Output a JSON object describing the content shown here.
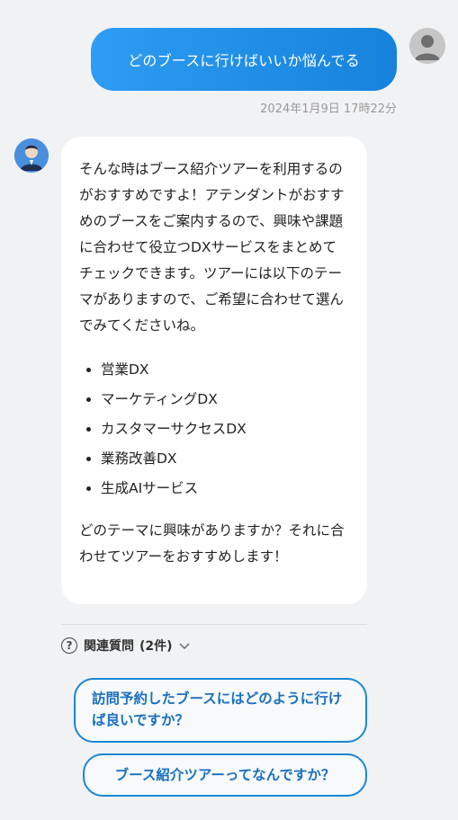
{
  "user_message": {
    "text": "どのブースに行けばいいか悩んでる",
    "timestamp": "2024年1月9日 17時22分"
  },
  "bot_message": {
    "intro": "そんな時はブース紹介ツアーを利用するのがおすすめですよ！アテンダントがおすすめのブースをご案内するので、興味や課題に合わせて役立つDXサービスをまとめてチェックできます。ツアーには以下のテーマがありますので、ご希望に合わせて選んでみてくださいね。",
    "themes": [
      "営業DX",
      "マーケティングDX",
      "カスタマーサクセスDX",
      "業務改善DX",
      "生成AIサービス"
    ],
    "outro": "どのテーマに興味がありますか？それに合わせてツアーをおすすめします！"
  },
  "related": {
    "icon": "question-circle-icon",
    "label": "関連質問",
    "count": "(2件)",
    "questions": [
      "訪問予約したブースにはどのように行けば良いですか？",
      "ブース紹介ツアーってなんですか？"
    ]
  },
  "colors": {
    "accent": "#1a86d8",
    "bubble_gradient_start": "#2e9cf2",
    "bubble_gradient_end": "#1682dc",
    "background": "#f1f2f4"
  }
}
